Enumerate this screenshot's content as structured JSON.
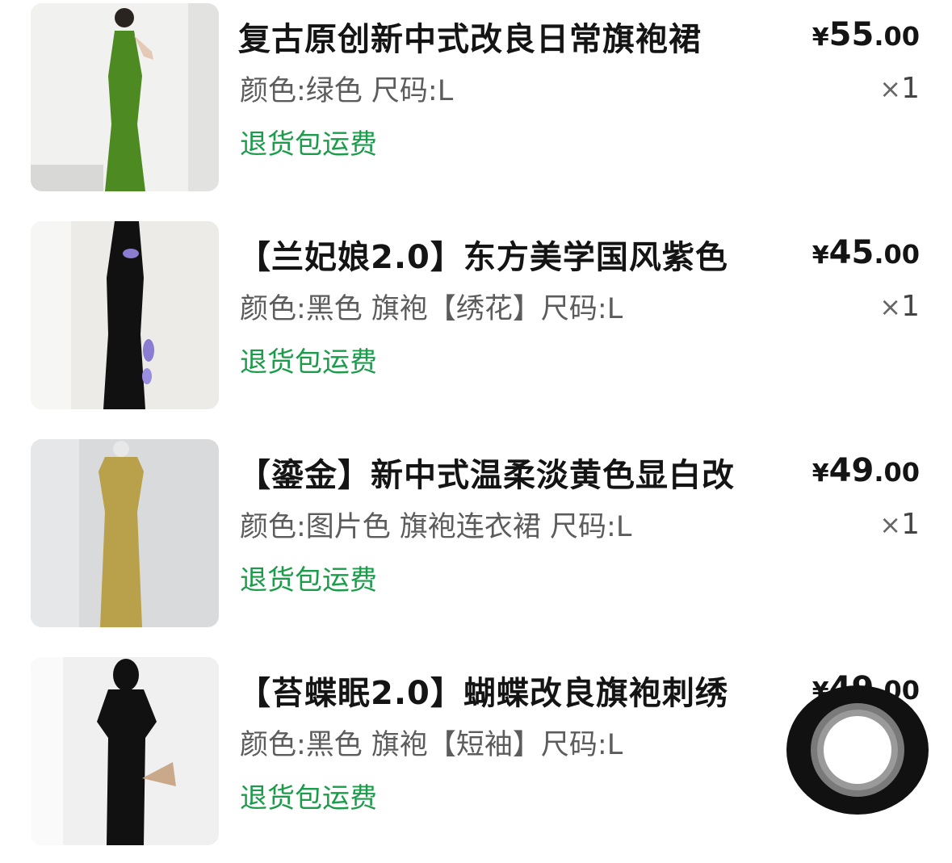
{
  "items": [
    {
      "title": "复古原创新中式改良日常旗袍裙",
      "spec": "颜色:绿色 尺码:L",
      "tag": "退货包运费",
      "price_currency": "¥",
      "price_int": "55",
      "price_dec": ".00",
      "qty_symbol": "×",
      "qty_value": "1",
      "dress_color": "#4e8a22"
    },
    {
      "title": "【兰妃娘2.0】东方美学国风紫色",
      "spec": "颜色:黑色 旗袍【绣花】尺码:L",
      "tag": "退货包运费",
      "price_currency": "¥",
      "price_int": "45",
      "price_dec": ".00",
      "qty_symbol": "×",
      "qty_value": "1",
      "dress_color": "#111111"
    },
    {
      "title": "【鎏金】新中式温柔淡黄色显白改",
      "spec": "颜色:图片色 旗袍连衣裙 尺码:L",
      "tag": "退货包运费",
      "price_currency": "¥",
      "price_int": "49",
      "price_dec": ".00",
      "qty_symbol": "×",
      "qty_value": "1",
      "dress_color": "#b9a04a"
    },
    {
      "title": "【苔蝶眠2.0】蝴蝶改良旗袍刺绣",
      "spec": "颜色:黑色 旗袍【短袖】尺码:L",
      "tag": "退货包运费",
      "price_currency": "¥",
      "price_int": "49",
      "price_dec": ".00",
      "qty_symbol": "",
      "qty_value": "",
      "dress_color": "#111111"
    }
  ],
  "colors": {
    "green_tag": "#1a9c4a",
    "title_text": "#141414",
    "spec_text": "#5c5c5c"
  }
}
